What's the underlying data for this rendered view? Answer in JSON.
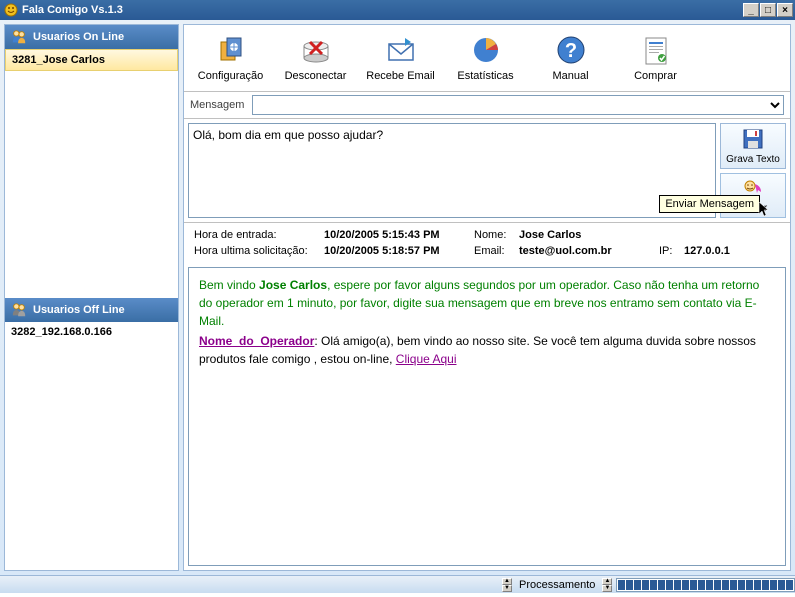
{
  "window": {
    "title": "Fala Comigo Vs.1.3"
  },
  "sidebar": {
    "online_title": "Usuarios On Line",
    "offline_title": "Usuarios Off Line",
    "online_users": [
      "3281_Jose Carlos"
    ],
    "offline_users": [
      "3282_192.168.0.166"
    ]
  },
  "toolbar": {
    "configuracao": "Configuração",
    "desconectar": "Desconectar",
    "recebe_email": "Recebe Email",
    "estatisticas": "Estatísticas",
    "manual": "Manual",
    "comprar": "Comprar"
  },
  "msg": {
    "label": "Mensagem",
    "value": ""
  },
  "side": {
    "grava": "Grava Texto",
    "enviar": "Enviar",
    "tooltip": "Enviar Mensagem"
  },
  "compose": {
    "value": "Olá, bom dia em que posso ajudar?"
  },
  "info": {
    "hora_entrada_lbl": "Hora de entrada:",
    "hora_entrada_val": "10/20/2005 5:15:43 PM",
    "hora_ultima_lbl": "Hora ultima solicitação:",
    "hora_ultima_val": "10/20/2005 5:18:57 PM",
    "nome_lbl": "Nome:",
    "nome_val": "Jose Carlos",
    "email_lbl": "Email:",
    "email_val": "teste@uol.com.br",
    "ip_lbl": "IP:",
    "ip_val": "127.0.0.1"
  },
  "chat": {
    "welcome_prefix": "Bem vindo ",
    "welcome_name": "Jose Carlos",
    "welcome_suffix": ", espere por favor alguns segundos por um operador. Caso não tenha um retorno do operador em 1 minuto, por favor, digite sua mensagem que em breve nos entramo sem contato via E-Mail.",
    "operator_name": "Nome_do_Operador",
    "operator_msg": ": Olá amigo(a), bem vindo ao nosso site. Se você tem alguma duvida sobre nossos produtos fale comigo , estou on-line, ",
    "operator_link": "Clique Aqui"
  },
  "status": {
    "label": "Processamento"
  }
}
